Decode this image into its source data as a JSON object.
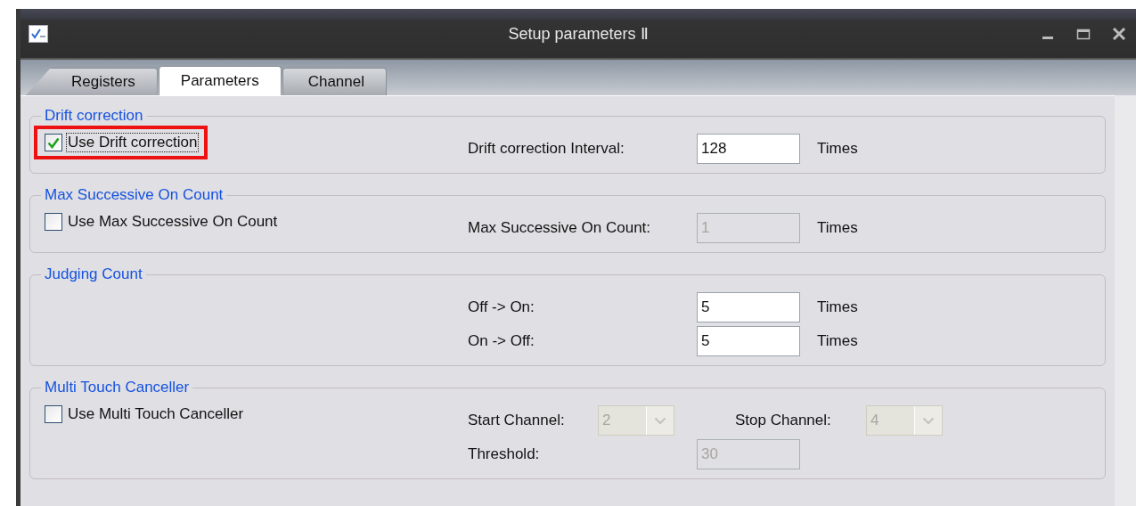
{
  "window": {
    "title": "Setup parameters Ⅱ"
  },
  "tabs": [
    {
      "label": "Registers",
      "selected": false
    },
    {
      "label": "Parameters",
      "selected": true
    },
    {
      "label": "Channel",
      "selected": false
    }
  ],
  "groups": [
    {
      "title": "Drift correction",
      "checkbox": {
        "label": "Use Drift correction",
        "checked": true,
        "focused": true,
        "highlighted": true
      },
      "rows": [
        {
          "cells": [
            {
              "kind": "text",
              "label": "Drift correction Interval:",
              "value": "128",
              "unit": "Times",
              "disabled": false
            }
          ]
        }
      ]
    },
    {
      "title": "Max Successive On Count",
      "checkbox": {
        "label": "Use Max Successive On Count",
        "checked": false,
        "focused": false,
        "highlighted": false
      },
      "rows": [
        {
          "cells": [
            {
              "kind": "text",
              "label": "Max Successive On Count:",
              "value": "1",
              "unit": "Times",
              "disabled": true
            }
          ]
        }
      ]
    },
    {
      "title": "Judging Count",
      "rows": [
        {
          "cells": [
            {
              "kind": "text",
              "label": "Off -> On:",
              "value": "5",
              "unit": "Times",
              "disabled": false
            }
          ]
        },
        {
          "cells": [
            {
              "kind": "text",
              "label": "On -> Off:",
              "value": "5",
              "unit": "Times",
              "disabled": false
            }
          ]
        }
      ]
    },
    {
      "title": "Multi Touch Canceller",
      "checkbox": {
        "label": "Use Multi Touch Canceller",
        "checked": false,
        "focused": false,
        "highlighted": false
      },
      "rows": [
        {
          "cells": [
            {
              "kind": "combo",
              "label": "Start Channel:",
              "value": "2",
              "disabled": true
            },
            {
              "kind": "combo",
              "label": "Stop Channel:",
              "value": "4",
              "disabled": true
            }
          ]
        },
        {
          "cells": [
            {
              "kind": "text",
              "label": "Threshold:",
              "value": "30",
              "disabled": true
            }
          ]
        }
      ]
    }
  ]
}
